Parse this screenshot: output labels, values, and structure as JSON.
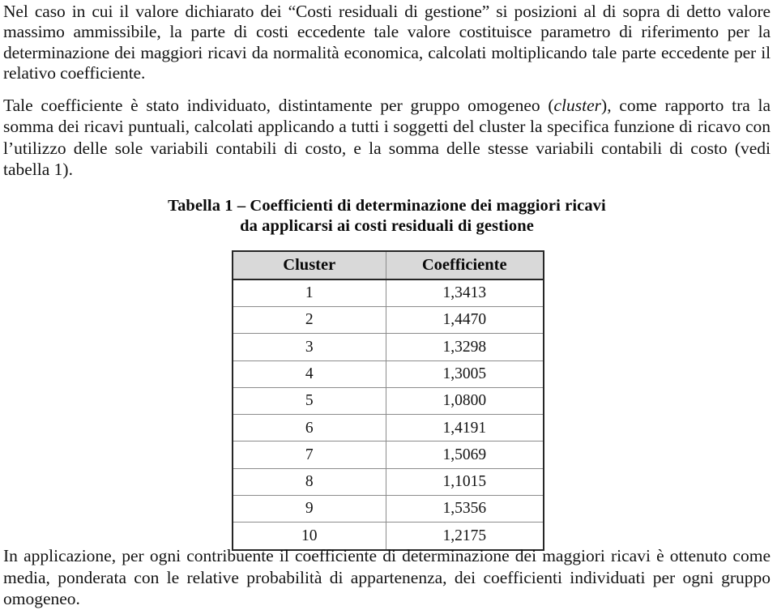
{
  "document": {
    "paragraph_1": "Nel caso in cui il valore dichiarato dei “Costi residuali di gestione” si posizioni al di sopra di detto valore massimo ammissibile, la parte di costi eccedente tale valore costituisce parametro di riferimento per la determinazione dei maggiori ricavi da normalità economica, calcolati moltiplicando tale parte eccedente per il relativo coefficiente.",
    "paragraph_2_part1": "Tale coefficiente è stato individuato, distintamente per gruppo omogeneo (",
    "paragraph_2_italic": "cluster",
    "paragraph_2_part2": "), come rapporto tra la somma dei ricavi puntuali, calcolati applicando a tutti i soggetti del cluster la specifica funzione di ricavo con l’utilizzo delle sole variabili contabili di costo, e la somma delle stesse variabili contabili di costo (vedi tabella 1).",
    "paragraph_3": "In applicazione, per ogni contribuente il coefficiente di determinazione dei maggiori ricavi è ottenuto come media, ponderata con le relative probabilità di appartenenza, dei coefficienti individuati per ogni gruppo omogeneo."
  },
  "table": {
    "caption_line_1": "Tabella 1 – Coefficienti di determinazione dei maggiori ricavi",
    "caption_line_2": "da applicarsi ai costi residuali di gestione",
    "headers": [
      "Cluster",
      "Coefficiente"
    ],
    "rows": [
      {
        "cluster": "1",
        "coefficiente": "1,3413"
      },
      {
        "cluster": "2",
        "coefficiente": "1,4470"
      },
      {
        "cluster": "3",
        "coefficiente": "1,3298"
      },
      {
        "cluster": "4",
        "coefficiente": "1,3005"
      },
      {
        "cluster": "5",
        "coefficiente": "1,0800"
      },
      {
        "cluster": "6",
        "coefficiente": "1,4191"
      },
      {
        "cluster": "7",
        "coefficiente": "1,5069"
      },
      {
        "cluster": "8",
        "coefficiente": "1,1015"
      },
      {
        "cluster": "9",
        "coefficiente": "1,5356"
      },
      {
        "cluster": "10",
        "coefficiente": "1,2175"
      }
    ],
    "header_background_color": "#d9d9d9",
    "border_color": "#262626",
    "inner_rule_color": "#8c8c8c"
  }
}
